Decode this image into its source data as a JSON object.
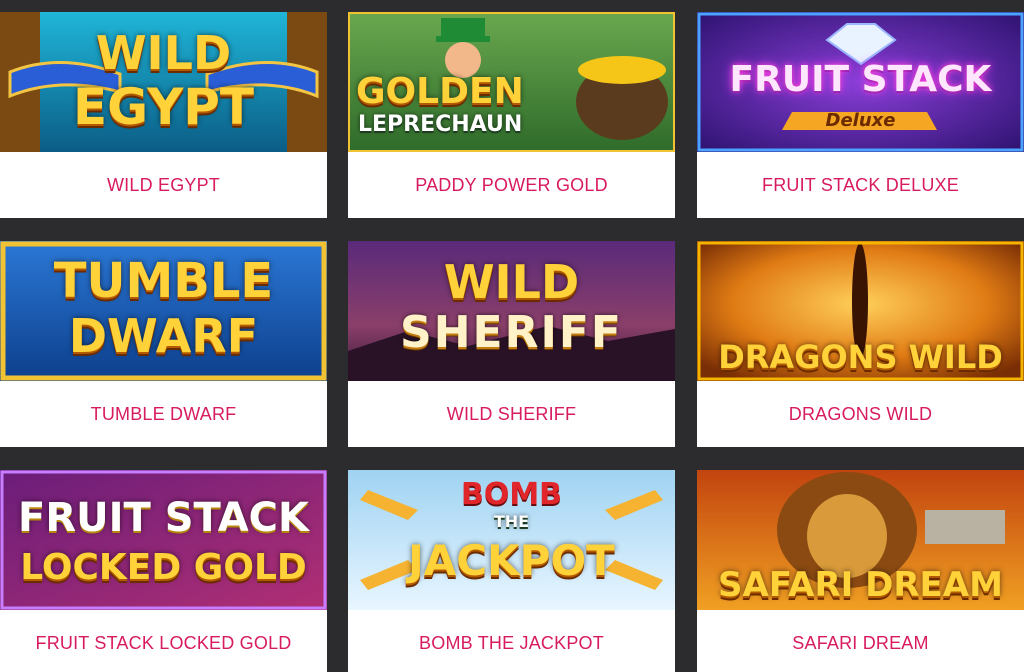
{
  "games": [
    {
      "title": "WILD EGYPT",
      "art_text": [
        "WILD",
        "EGYPT"
      ]
    },
    {
      "title": "PADDY POWER GOLD",
      "art_text": [
        "GOLDEN",
        "LEPRECHAUN"
      ]
    },
    {
      "title": "FRUIT STACK DELUXE",
      "art_text": [
        "FRUIT STACK",
        "Deluxe"
      ]
    },
    {
      "title": "TUMBLE DWARF",
      "art_text": [
        "TUMBLE",
        "DWARF"
      ]
    },
    {
      "title": "WILD SHERIFF",
      "art_text": [
        "WILD",
        "SHERIFF"
      ]
    },
    {
      "title": "DRAGONS WILD",
      "art_text": [
        "DRAGONS WILD"
      ]
    },
    {
      "title": "FRUIT STACK LOCKED GOLD",
      "art_text": [
        "FRUIT STACK",
        "LOCKED GOLD"
      ]
    },
    {
      "title": "BOMB THE JACKPOT",
      "art_text": [
        "BOMB",
        "THE",
        "JACKPOT"
      ]
    },
    {
      "title": "SAFARI DREAM",
      "art_text": [
        "SAFARI DREAM"
      ]
    }
  ],
  "colors": {
    "page_background": "#2c2c2e",
    "card_background": "#ffffff",
    "title_text": "#d81b60"
  }
}
